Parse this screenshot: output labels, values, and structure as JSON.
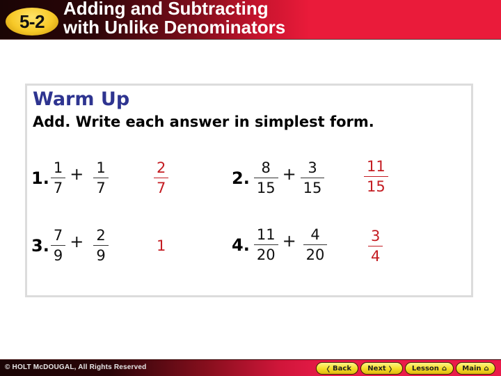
{
  "header": {
    "badge": "5-2",
    "title_line1": "Adding and Subtracting",
    "title_line2": "with Unlike Denominators"
  },
  "content": {
    "heading": "Warm Up",
    "instruction": "Add. Write each answer in simplest form.",
    "problems": [
      {
        "number": "1.",
        "a": {
          "num": "1",
          "den": "7"
        },
        "operator": "+",
        "b": {
          "num": "1",
          "den": "7"
        },
        "answer": {
          "num": "2",
          "den": "7"
        }
      },
      {
        "number": "2.",
        "a": {
          "num": "8",
          "den": "15"
        },
        "operator": "+",
        "b": {
          "num": "3",
          "den": "15"
        },
        "answer": {
          "num": "11",
          "den": "15"
        }
      },
      {
        "number": "3.",
        "a": {
          "num": "7",
          "den": "9"
        },
        "operator": "+",
        "b": {
          "num": "2",
          "den": "9"
        },
        "answer": {
          "whole": "1"
        }
      },
      {
        "number": "4.",
        "a": {
          "num": "11",
          "den": "20"
        },
        "operator": "+",
        "b": {
          "num": "4",
          "den": "20"
        },
        "answer": {
          "num": "3",
          "den": "4"
        }
      }
    ]
  },
  "footer": {
    "copyright": "© HOLT McDOUGAL, All Rights Reserved",
    "nav": {
      "back": {
        "label": "Back",
        "icon": "chevron-left-icon",
        "glyph": "〈"
      },
      "next": {
        "label": "Next",
        "icon": "chevron-right-icon",
        "glyph": "〉"
      },
      "lesson": {
        "label": "Lesson",
        "icon": "home-icon",
        "glyph": "⌂"
      },
      "main": {
        "label": "Main",
        "icon": "home-icon",
        "glyph": "⌂"
      }
    }
  },
  "colors": {
    "heading": "#2e3490",
    "answer": "#c41c22",
    "header_red": "#ea1b3a",
    "badge_yellow": "#f7c928"
  }
}
